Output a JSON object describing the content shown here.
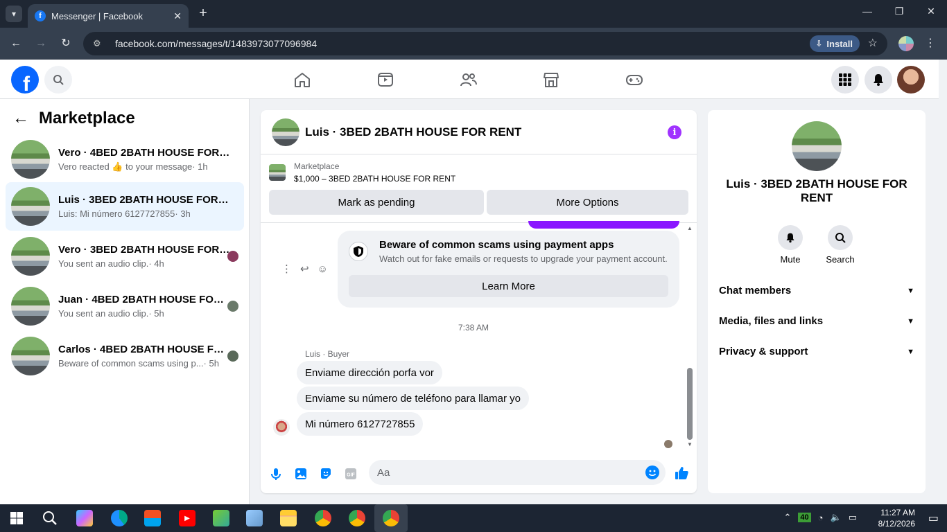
{
  "browser": {
    "tab_title": "Messenger | Facebook",
    "url": "facebook.com/messages/t/1483973077096984",
    "install_label": "Install"
  },
  "sidebar": {
    "title": "Marketplace",
    "conversations": [
      {
        "name": "Vero · 4BED 2BATH HOUSE FOR RE...",
        "sub": "Vero reacted 👍 to your message",
        "time": "· 1h"
      },
      {
        "name": "Luis · 3BED 2BATH HOUSE FOR RE...",
        "sub": "Luis: Mi número 6127727855",
        "time": "· 3h"
      },
      {
        "name": "Vero · 3BED 2BATH HOUSE FOR ...",
        "sub": "You sent an audio clip.",
        "time": "· 4h"
      },
      {
        "name": "Juan · 4BED 2BATH HOUSE FOR ...",
        "sub": "You sent an audio clip.",
        "time": "· 5h"
      },
      {
        "name": "Carlos · 4BED 2BATH HOUSE FO...",
        "sub": "Beware of common scams using p...",
        "time": "· 5h"
      }
    ]
  },
  "chat": {
    "title": "Luis · 3BED 2BATH HOUSE FOR RENT",
    "listing_label": "Marketplace",
    "listing_desc": "$1,000 – 3BED 2BATH HOUSE FOR RENT",
    "btn_pending": "Mark as pending",
    "btn_more": "More Options",
    "scam_title": "Beware of common scams using payment apps",
    "scam_desc": "Watch out for fake emails or requests to upgrade your payment account.",
    "scam_button": "Learn More",
    "timestamp": "7:38 AM",
    "sender_label": "Luis · Buyer",
    "messages": [
      "Enviame dirección porfa vor",
      "Enviame su número de teléfono para llamar yo",
      "Mi número 6127727855"
    ],
    "composer_placeholder": "Aa"
  },
  "info_panel": {
    "title": "Luis · 3BED 2BATH HOUSE FOR RENT",
    "mute_label": "Mute",
    "search_label": "Search",
    "sections": [
      "Chat members",
      "Media, files and links",
      "Privacy & support"
    ]
  },
  "taskbar": {
    "battery": "40",
    "time": "11:27 AM",
    "date": "8/12/2026"
  },
  "colors": {
    "fb_blue": "#0866ff",
    "messenger_purple": "#a033ff",
    "active_conv_bg": "#ebf5ff"
  }
}
